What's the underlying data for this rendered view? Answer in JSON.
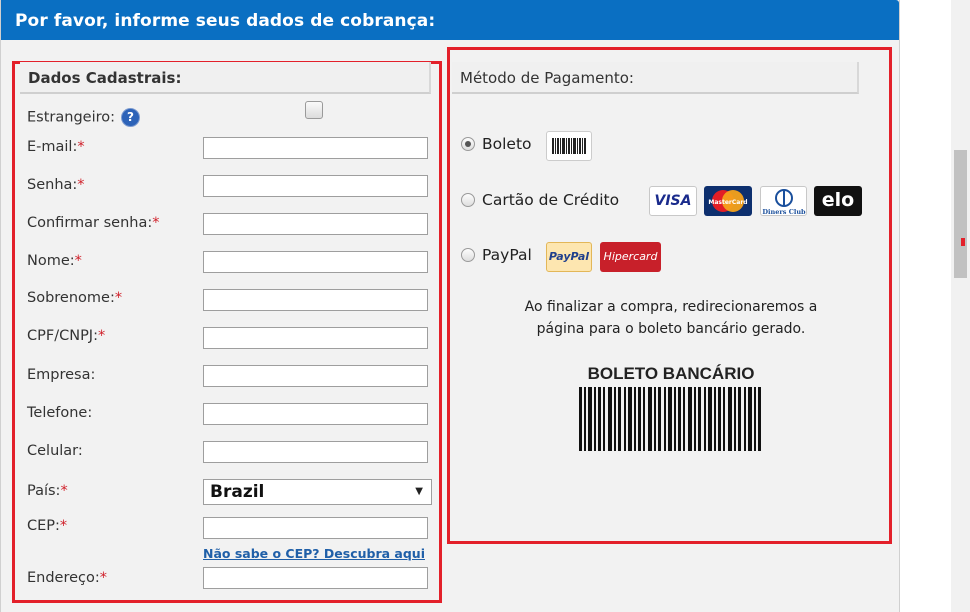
{
  "header": {
    "title": "Por favor, informe seus dados de cobrança:"
  },
  "left_section": {
    "title": "Dados Cadastrais:",
    "fields": [
      {
        "label": "Estrangeiro:",
        "required": false
      },
      {
        "label": "E-mail:",
        "required": true
      },
      {
        "label": "Senha:",
        "required": true
      },
      {
        "label": "Confirmar senha:",
        "required": true
      },
      {
        "label": "Nome:",
        "required": true
      },
      {
        "label": "Sobrenome:",
        "required": true
      },
      {
        "label": "CPF/CNPJ:",
        "required": true
      },
      {
        "label": "Empresa:",
        "required": false
      },
      {
        "label": "Telefone:",
        "required": false
      },
      {
        "label": "Celular:",
        "required": false
      },
      {
        "label": "País:",
        "required": true
      },
      {
        "label": "CEP:",
        "required": true
      },
      {
        "label": "Endereço:",
        "required": true
      }
    ],
    "required_mark": "*",
    "help_icon": "?",
    "country_value": "Brazil",
    "cep_link": "Não sabe o CEP? Descubra aqui"
  },
  "right_section": {
    "title": "Método de Pagamento:",
    "options": [
      {
        "label": "Boleto",
        "selected": true
      },
      {
        "label": "Cartão de Crédito",
        "selected": false
      },
      {
        "label": "PayPal",
        "selected": false
      }
    ],
    "cards": {
      "visa": "VISA",
      "mastercard": "MasterCard",
      "diners": "Diners Club",
      "elo": "elo",
      "paypal": "PayPal",
      "hipercard": "Hipercard"
    },
    "info_text_line1": "Ao finalizar a compra, redirecionaremos a",
    "info_text_line2": "página para o boleto bancário gerado.",
    "boleto_label": "BOLETO BANCÁRIO"
  },
  "colors": {
    "header_bg": "#0a6fc2",
    "highlight_border": "#e3202a",
    "link": "#1f5fa8"
  }
}
